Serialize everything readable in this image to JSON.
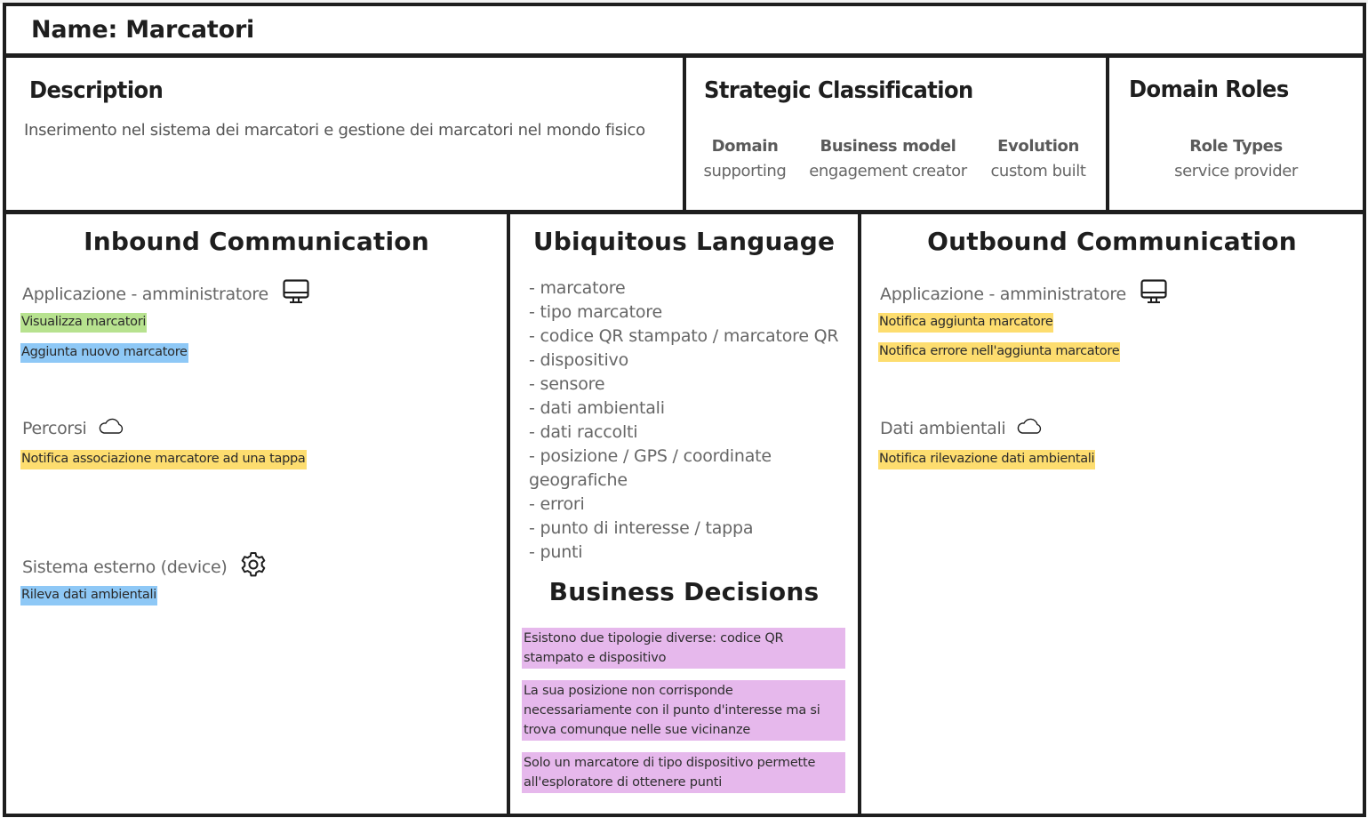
{
  "canvas": {
    "name_label": "Name: Marcatori",
    "description": {
      "title": "Description",
      "text": "Inserimento nel sistema dei marcatori e gestione dei marcatori nel mondo fisico"
    },
    "strategic_classification": {
      "title": "Strategic Classification",
      "columns": [
        {
          "label": "Domain",
          "value": "supporting"
        },
        {
          "label": "Business model",
          "value": "engagement creator"
        },
        {
          "label": "Evolution",
          "value": "custom built"
        }
      ]
    },
    "domain_roles": {
      "title": "Domain Roles",
      "label": "Role Types",
      "value": "service provider"
    },
    "inbound": {
      "title": "Inbound Communication",
      "groups": [
        {
          "name": "Applicazione - amministratore",
          "icon": "monitor-icon",
          "messages": [
            {
              "text": "Visualizza marcatori",
              "type": "query",
              "color": "#b7e28f"
            },
            {
              "text": "Aggiunta nuovo marcatore",
              "type": "command",
              "color": "#8ec8f6"
            }
          ]
        },
        {
          "name": "Percorsi",
          "icon": "cloud-icon",
          "messages": [
            {
              "text": "Notifica associazione marcatore ad una tappa",
              "type": "event",
              "color": "#fddd6f"
            }
          ]
        },
        {
          "name": "Sistema esterno (device)",
          "icon": "gear-icon",
          "messages": [
            {
              "text": "Rileva dati ambientali",
              "type": "command",
              "color": "#8ec8f6"
            }
          ]
        }
      ]
    },
    "ubiquitous_language": {
      "title": "Ubiquitous Language",
      "terms": [
        "- marcatore",
        "- tipo marcatore",
        "- codice QR stampato / marcatore QR",
        "- dispositivo",
        "- sensore",
        "- dati ambientali",
        "- dati raccolti",
        "- posizione / GPS / coordinate geografiche",
        "- errori",
        "- punto di interesse / tappa",
        "- punti"
      ]
    },
    "business_decisions": {
      "title": "Business Decisions",
      "color": "#e6b8ec",
      "items": [
        "Esistono due tipologie diverse: codice QR stampato e dispositivo",
        "La sua posizione non corrisponde necessariamente con il punto d'interesse ma si trova comunque nelle sue vicinanze",
        "Solo un marcatore di tipo dispositivo permette all'esploratore di ottenere punti"
      ]
    },
    "outbound": {
      "title": "Outbound Communication",
      "groups": [
        {
          "name": "Applicazione - amministratore",
          "icon": "monitor-icon",
          "messages": [
            {
              "text": "Notifica aggiunta marcatore",
              "type": "event",
              "color": "#fddd6f"
            },
            {
              "text": "Notifica errore nell'aggiunta marcatore",
              "type": "event",
              "color": "#fddd6f"
            }
          ]
        },
        {
          "name": "Dati ambientali",
          "icon": "cloud-icon",
          "messages": [
            {
              "text": "Notifica rilevazione dati ambientali",
              "type": "event",
              "color": "#fddd6f"
            }
          ]
        }
      ]
    }
  }
}
